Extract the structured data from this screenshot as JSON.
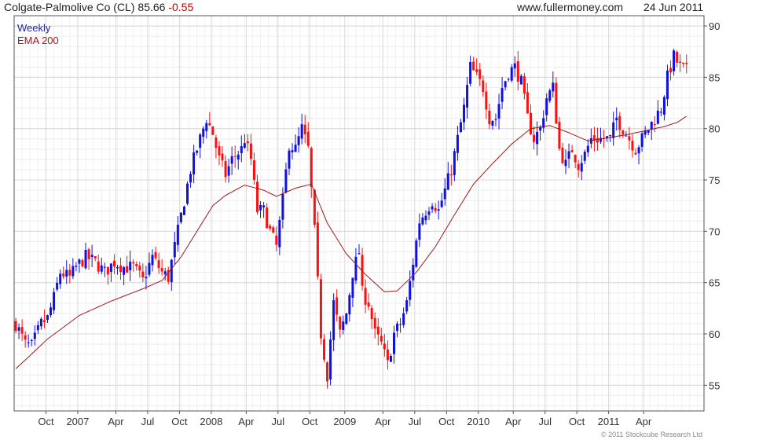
{
  "header": {
    "title": "Colgate-Palmolive Co (CL)",
    "price": "85.66",
    "change": "-0.55",
    "site": "www.fullermoney.com",
    "date": "24 Jun 2011"
  },
  "footer": {
    "copyright": "© 2011 Stockcube Research Ltd"
  },
  "colors": {
    "up": "#1010e0",
    "down": "#ff1010",
    "ema": "#a01818",
    "grid": "#d8d8d8",
    "frame": "#555555"
  },
  "chart_data": {
    "type": "candlestick",
    "interval": "Weekly",
    "ylim": [
      52.5,
      91
    ],
    "yticks": [
      55,
      60,
      65,
      70,
      75,
      80,
      85,
      90
    ],
    "xlim": [
      0,
      217
    ],
    "xticks": [
      {
        "label": "Oct",
        "week": 10
      },
      {
        "label": "2007",
        "week": 20
      },
      {
        "label": "Apr",
        "week": 32
      },
      {
        "label": "Jul",
        "week": 42
      },
      {
        "label": "Oct",
        "week": 52
      },
      {
        "label": "2008",
        "week": 62
      },
      {
        "label": "Apr",
        "week": 73
      },
      {
        "label": "Jul",
        "week": 83
      },
      {
        "label": "Oct",
        "week": 93
      },
      {
        "label": "2009",
        "week": 104
      },
      {
        "label": "Apr",
        "week": 116
      },
      {
        "label": "Jul",
        "week": 126
      },
      {
        "label": "Oct",
        "week": 136
      },
      {
        "label": "2010",
        "week": 146
      },
      {
        "label": "Apr",
        "week": 157
      },
      {
        "label": "Jul",
        "week": 167
      },
      {
        "label": "Oct",
        "week": 177
      },
      {
        "label": "2011",
        "week": 187
      },
      {
        "label": "Apr",
        "week": 198
      }
    ],
    "series": [
      {
        "name": "Weekly",
        "anchors": [
          [
            0,
            61
          ],
          [
            3,
            59
          ],
          [
            5,
            58.8
          ],
          [
            8,
            61
          ],
          [
            10,
            61.5
          ],
          [
            12,
            63.5
          ],
          [
            14,
            66
          ],
          [
            17,
            65.5
          ],
          [
            19,
            66.5
          ],
          [
            22,
            67.5
          ],
          [
            25,
            67
          ],
          [
            28,
            66
          ],
          [
            31,
            67
          ],
          [
            34,
            66.5
          ],
          [
            37,
            66.5
          ],
          [
            40,
            65.2
          ],
          [
            43,
            67.5
          ],
          [
            46,
            66
          ],
          [
            48,
            65.5
          ],
          [
            51,
            70
          ],
          [
            53,
            73
          ],
          [
            55,
            76
          ],
          [
            58,
            79
          ],
          [
            60,
            81
          ],
          [
            62,
            79.5
          ],
          [
            64,
            77
          ],
          [
            66,
            75.5
          ],
          [
            68,
            77
          ],
          [
            71,
            78
          ],
          [
            72,
            79
          ],
          [
            74,
            77
          ],
          [
            76,
            72
          ],
          [
            78,
            72
          ],
          [
            80,
            70
          ],
          [
            82,
            68.5
          ],
          [
            84,
            73
          ],
          [
            86,
            78.5
          ],
          [
            88,
            78
          ],
          [
            90,
            80
          ],
          [
            92,
            78
          ],
          [
            94,
            70
          ],
          [
            96,
            60
          ],
          [
            98,
            56
          ],
          [
            100,
            63
          ],
          [
            102,
            60
          ],
          [
            104,
            62
          ],
          [
            106,
            66
          ],
          [
            108,
            68
          ],
          [
            109,
            64
          ],
          [
            111,
            63
          ],
          [
            113,
            60
          ],
          [
            115,
            59
          ],
          [
            117,
            57
          ],
          [
            119,
            60
          ],
          [
            121,
            61
          ],
          [
            123,
            63
          ],
          [
            125,
            67
          ],
          [
            127,
            71
          ],
          [
            129,
            72
          ],
          [
            131,
            73
          ],
          [
            133,
            72
          ],
          [
            135,
            74
          ],
          [
            137,
            76
          ],
          [
            139,
            79
          ],
          [
            141,
            82
          ],
          [
            143,
            86
          ],
          [
            145,
            85
          ],
          [
            147,
            84
          ],
          [
            149,
            81
          ],
          [
            151,
            81
          ],
          [
            153,
            84
          ],
          [
            155,
            85.5
          ],
          [
            157,
            86
          ],
          [
            159,
            84.5
          ],
          [
            161,
            81
          ],
          [
            163,
            79
          ],
          [
            165,
            80
          ],
          [
            167,
            83
          ],
          [
            169,
            84
          ],
          [
            171,
            78
          ],
          [
            173,
            76.5
          ],
          [
            175,
            78
          ],
          [
            177,
            76.5
          ],
          [
            179,
            77.5
          ],
          [
            181,
            79
          ],
          [
            183,
            79
          ],
          [
            185,
            79
          ],
          [
            187,
            79
          ],
          [
            189,
            81
          ],
          [
            191,
            80
          ],
          [
            193,
            79
          ],
          [
            195,
            78
          ],
          [
            197,
            79
          ],
          [
            199,
            80
          ],
          [
            201,
            81
          ],
          [
            203,
            82
          ],
          [
            205,
            85
          ],
          [
            207,
            87
          ],
          [
            209,
            86
          ],
          [
            211,
            85.66
          ]
        ]
      },
      {
        "name": "EMA 200",
        "anchors": [
          [
            0,
            56.6
          ],
          [
            10,
            59.5
          ],
          [
            20,
            61.8
          ],
          [
            30,
            63.2
          ],
          [
            40,
            64.4
          ],
          [
            46,
            65.2
          ],
          [
            52,
            67.5
          ],
          [
            58,
            70.5
          ],
          [
            62,
            72.5
          ],
          [
            66,
            73.5
          ],
          [
            72,
            74.5
          ],
          [
            78,
            74
          ],
          [
            82,
            73.4
          ],
          [
            88,
            74.2
          ],
          [
            93,
            74.6
          ],
          [
            98,
            70.8
          ],
          [
            104,
            67.8
          ],
          [
            110,
            65.8
          ],
          [
            116,
            64.1
          ],
          [
            120,
            64.2
          ],
          [
            126,
            66
          ],
          [
            132,
            68.5
          ],
          [
            138,
            71.6
          ],
          [
            144,
            74.6
          ],
          [
            150,
            76.6
          ],
          [
            156,
            78.5
          ],
          [
            162,
            80
          ],
          [
            168,
            80.3
          ],
          [
            174,
            79.6
          ],
          [
            180,
            78.8
          ],
          [
            186,
            79.1
          ],
          [
            192,
            79.4
          ],
          [
            198,
            79.8
          ],
          [
            204,
            80.2
          ],
          [
            208,
            80.6
          ],
          [
            211,
            81.2
          ]
        ]
      }
    ]
  }
}
